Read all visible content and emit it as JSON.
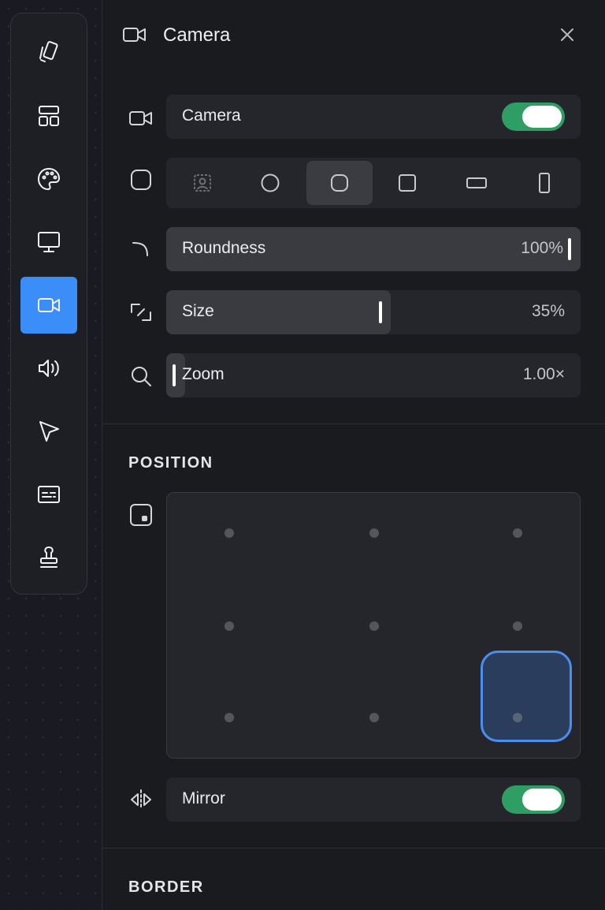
{
  "toolbar": {
    "tools": [
      {
        "icon": "cards-icon"
      },
      {
        "icon": "layout-icon"
      },
      {
        "icon": "palette-icon"
      },
      {
        "icon": "monitor-icon"
      },
      {
        "icon": "camera-icon",
        "active": true
      },
      {
        "icon": "speaker-icon"
      },
      {
        "icon": "cursor-icon"
      },
      {
        "icon": "captions-icon"
      },
      {
        "icon": "stamp-icon"
      }
    ]
  },
  "panel": {
    "title": "Camera",
    "camera_toggle": {
      "label": "Camera",
      "on": true
    },
    "shapes": {
      "options": [
        "portrait-icon",
        "circle-icon",
        "rounded-square-icon",
        "square-icon",
        "wide-rect-icon",
        "tall-rect-icon"
      ],
      "selected_index": 2
    },
    "roundness": {
      "label": "Roundness",
      "value": "100%",
      "fraction": 1.0
    },
    "size": {
      "label": "Size",
      "value": "35%",
      "fraction": 0.35
    },
    "zoom": {
      "label": "Zoom",
      "value": "1.00×",
      "fraction": 0.0
    },
    "position": {
      "title": "POSITION",
      "selected": "bottom-right"
    },
    "mirror_toggle": {
      "label": "Mirror",
      "on": true
    },
    "border": {
      "title": "BORDER"
    }
  },
  "colors": {
    "accent": "#3b8df8",
    "toggle_on": "#2f9e64",
    "selected_fill": "#2a3d5c"
  }
}
